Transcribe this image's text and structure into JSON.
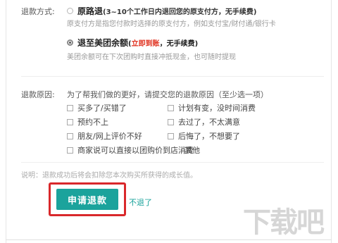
{
  "refund_method": {
    "label": "退款方式:",
    "options": [
      {
        "title": "原路退",
        "subtitle": "(3~10个工作日内退回您的原支付方，无手续费)",
        "description": "原支付方是指您付款时选择的原支付方，例如支付宝/财付通/银行卡",
        "selected": false
      },
      {
        "title": "退至美团余额",
        "subtitle_open": "(",
        "subtitle_highlight": "立即到账",
        "subtitle_rest": "，无手续费)",
        "description": "美团余额可在下次团购时直接冲抵现金，也可随时提现",
        "selected": true
      }
    ]
  },
  "refund_reason": {
    "label": "退款原因:",
    "hint": "为了帮我们做的更好，请提交您的退款原因（至少选一项）",
    "reasons_left": [
      "买多了/买错了",
      "预约不上",
      "朋友/网上评价不好",
      "商家说可以直接以团购价到店消费"
    ],
    "reasons_right": [
      "计划有变，没时间消费",
      "去过了，不太满意",
      "后悔了，不想要了",
      "其他"
    ]
  },
  "note": "说明：退款成功后将会扣除您本次购买所获得的成长值。",
  "submit_label": "申请退款",
  "cancel_label": "不退了",
  "watermark": "下载吧",
  "colors": {
    "accent": "#1ba39c",
    "highlight": "#d9282b",
    "emphasis": "#e0301e"
  }
}
